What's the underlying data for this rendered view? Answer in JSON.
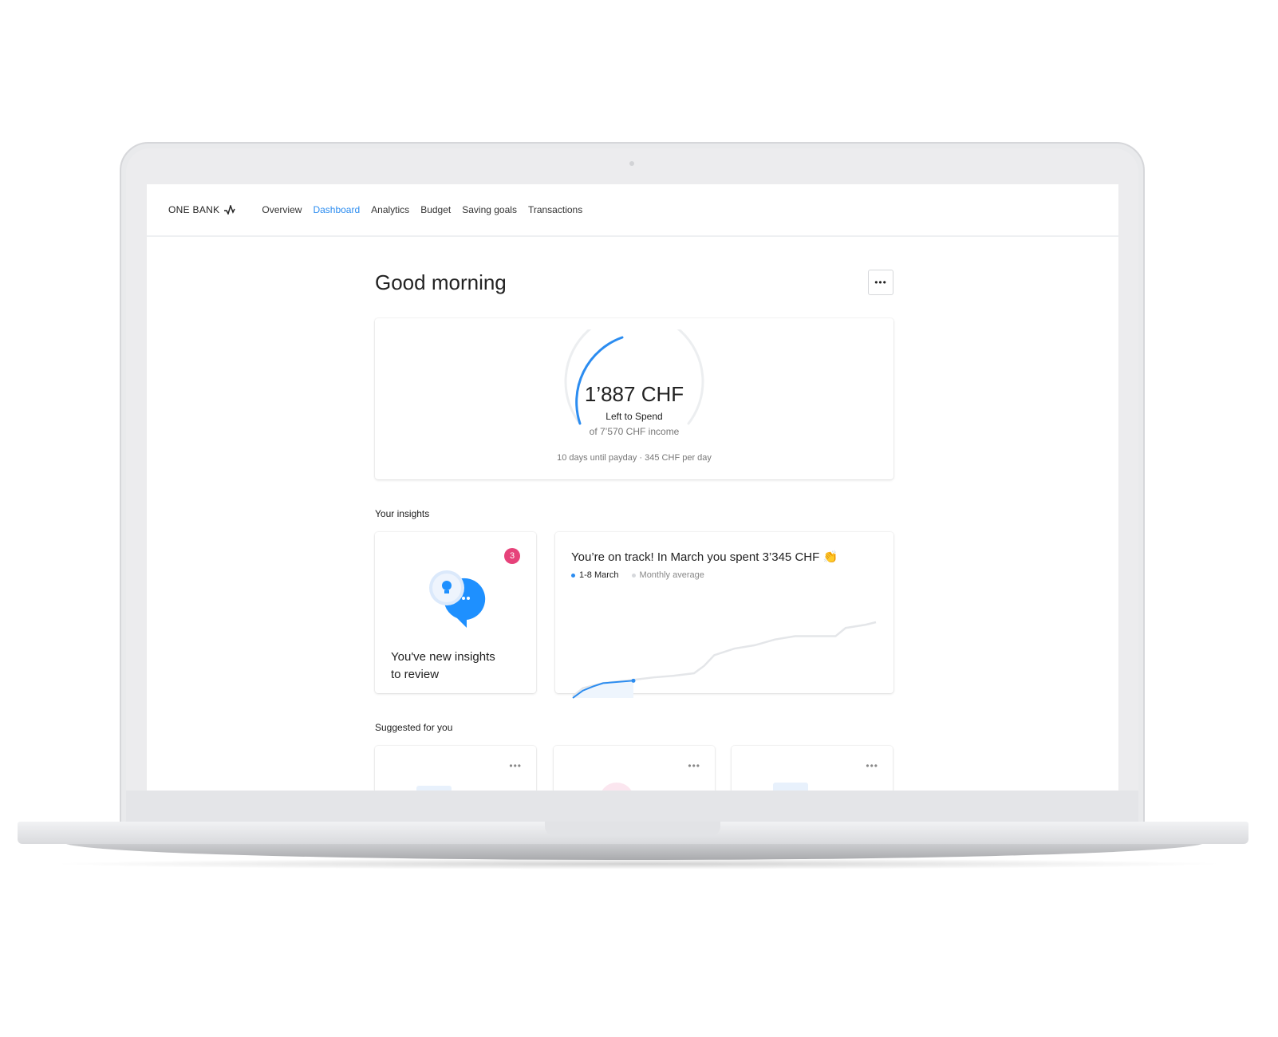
{
  "nav": {
    "brand": "ONE BANK",
    "items": [
      {
        "label": "Overview",
        "active": false
      },
      {
        "label": "Dashboard",
        "active": true
      },
      {
        "label": "Analytics",
        "active": false
      },
      {
        "label": "Budget",
        "active": false
      },
      {
        "label": "Saving goals",
        "active": false
      },
      {
        "label": "Transactions",
        "active": false
      }
    ]
  },
  "page": {
    "title": "Good morning",
    "more_icon": "ellipsis-icon"
  },
  "budget": {
    "amount": "1’887 CHF",
    "label": "Left to Spend",
    "income": "of 7’570 CHF income",
    "footer": "10 days until payday · 345 CHF per day",
    "spent_fraction": 0.25,
    "accent": "#2b8cf0"
  },
  "insights": {
    "section_title": "Your insights",
    "card": {
      "text_line1": "You've new insights",
      "text_line2": "to review",
      "badge": "3",
      "badge_color": "#e6427a"
    },
    "chart_card": {
      "title": "You’re on track! In March you spent 3’345 CHF",
      "emoji": "👏",
      "legend": [
        {
          "label": "1-8 March",
          "color": "#2b8cf0"
        },
        {
          "label": "Monthly average",
          "color": "#d6d8dc"
        }
      ]
    }
  },
  "chart_data": {
    "type": "line",
    "series": [
      {
        "name": "Monthly average",
        "color": "#e4e6e9",
        "x": [
          1,
          2,
          4,
          7,
          9,
          11,
          13,
          14,
          15,
          17,
          19,
          21,
          23,
          27,
          28,
          30,
          31
        ],
        "values": [
          2,
          12,
          18,
          22,
          25,
          27,
          30,
          39,
          52,
          60,
          64,
          71,
          75,
          75,
          85,
          89,
          92
        ]
      },
      {
        "name": "1-8 March",
        "color": "#2b8cf0",
        "x": [
          1,
          2,
          3,
          4,
          7
        ],
        "values": [
          0,
          9,
          14,
          18,
          21
        ]
      }
    ],
    "xlim": [
      1,
      31
    ],
    "ylim": [
      0,
      92
    ],
    "grid": false
  },
  "suggested": {
    "section_title": "Suggested for you",
    "cards": [
      {
        "more": "•••"
      },
      {
        "more": "•••"
      },
      {
        "more": "•••"
      }
    ]
  }
}
